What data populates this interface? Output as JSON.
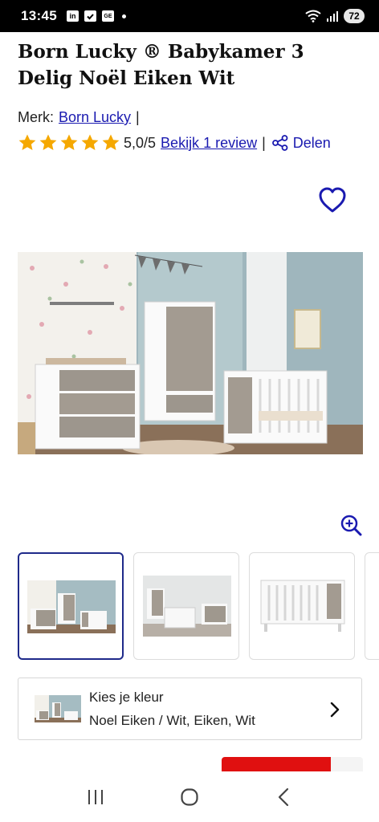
{
  "status_bar": {
    "time": "13:45",
    "left_icons": [
      "linkedin-icon",
      "check-icon",
      "ge-icon",
      "dot-icon"
    ],
    "linkedin_label": "in",
    "ge_label": "GE",
    "battery": "72"
  },
  "product": {
    "title": "Born Lucky ® Babykamer 3 Delig Noël Eiken Wit",
    "brand_label": "Merk:",
    "brand_name": "Born Lucky",
    "brand_sep": "|",
    "stars": 5,
    "rating_text": "5,0/5",
    "review_link": "Bekijk 1 review",
    "rating_sep": "|",
    "share_label": "Delen"
  },
  "color_selector": {
    "label": "Kies je kleur",
    "value": "Noel Eiken / Wit, Eiken, Wit"
  },
  "colors": {
    "link": "#1a1ab0",
    "star": "#f5a800",
    "active_border": "#1f2a8a",
    "cta": "#e01010"
  }
}
